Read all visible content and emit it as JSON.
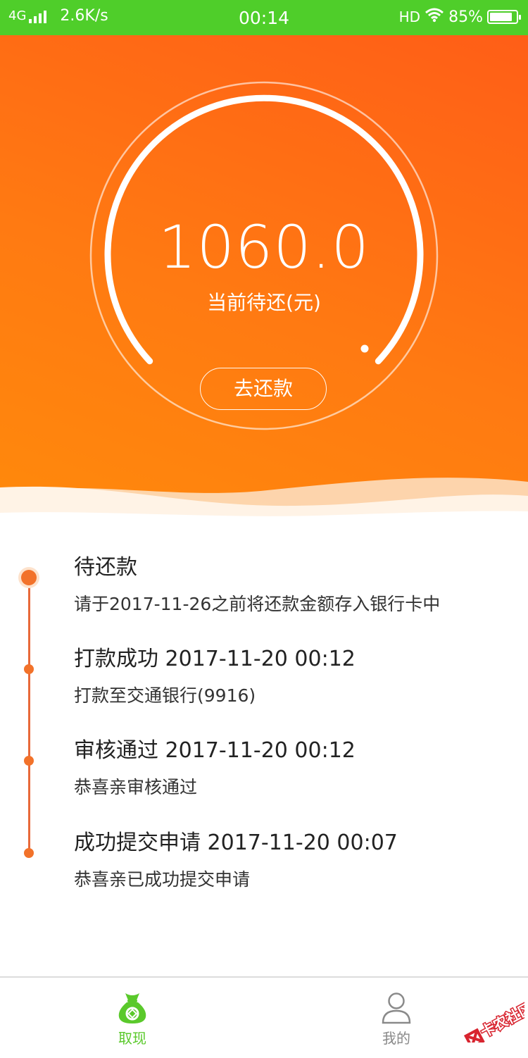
{
  "status_bar": {
    "network": "4G",
    "speed": "2.6K/s",
    "time": "00:14",
    "hd": "HD",
    "battery": "85%",
    "battery_level": 0.85
  },
  "repayment": {
    "amount": "1060.0",
    "caption": "当前待还(元)",
    "button_label": "去还款"
  },
  "timeline": [
    {
      "title": "待还款",
      "desc": "请于2017-11-26之前将还款金额存入银行卡中",
      "current": true
    },
    {
      "title": "打款成功 2017-11-20 00:12",
      "desc": "打款至交通银行(9916)",
      "current": false
    },
    {
      "title": "审核通过 2017-11-20 00:12",
      "desc": "恭喜亲审核通过",
      "current": false
    },
    {
      "title": "成功提交申请 2017-11-20 00:07",
      "desc": "恭喜亲已成功提交申请",
      "current": false
    }
  ],
  "tabs": [
    {
      "label": "取现",
      "icon": "money-bag-icon",
      "active": true
    },
    {
      "label": "我的",
      "icon": "user-icon",
      "active": false
    }
  ],
  "watermark": {
    "text": "卡农社区"
  },
  "colors": {
    "status_bar": "#4fce2a",
    "accent_orange": "#ff7a12",
    "tab_active": "#5ac92b",
    "tab_inactive": "#888888",
    "timeline": "#e8693a"
  }
}
